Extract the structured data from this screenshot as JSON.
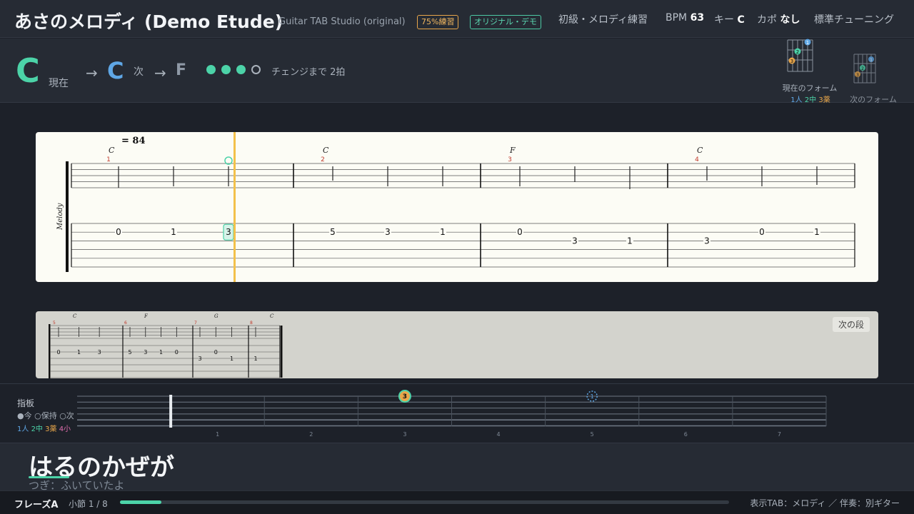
{
  "header": {
    "title": "あさのメロディ (Demo Etude)",
    "subtitle": "Guitar TAB Studio (original)",
    "badge_practice": "75%練習",
    "badge_demo": "オリジナル・デモ",
    "level": "初級・メロディ練習",
    "bpm_label": "BPM",
    "bpm_value": "63",
    "key_label": "キー",
    "key_value": "C",
    "capo_label": "カポ",
    "capo_value": "なし",
    "tuning": "標準チューニング"
  },
  "chords": {
    "current": "C",
    "current_label": "現在",
    "next": "C",
    "next_label": "次",
    "after": "F",
    "arrow": "→",
    "beats_total": 4,
    "beats_done": 3,
    "countdown": "チェンジまで 2拍",
    "current_form_label": "現在のフォーム",
    "next_form_label": "次のフォーム",
    "finger_legend": [
      "1人",
      "2中",
      "3薬"
    ]
  },
  "tab": {
    "tempo": "= 84",
    "track": "Melody",
    "measures": [
      {
        "num": "1",
        "chord": "C",
        "notes": [
          {
            "fret": "0",
            "str": 2
          },
          {
            "fret": "1",
            "str": 2
          },
          {
            "fret": "3",
            "str": 2
          }
        ]
      },
      {
        "num": "2",
        "chord": "C",
        "notes": [
          {
            "fret": "5",
            "str": 2
          },
          {
            "fret": "3",
            "str": 2
          },
          {
            "fret": "1",
            "str": 2
          }
        ]
      },
      {
        "num": "3",
        "chord": "F",
        "notes": [
          {
            "fret": "0",
            "str": 2
          },
          {
            "fret": "3",
            "str": 3
          },
          {
            "fret": "1",
            "str": 3
          }
        ]
      },
      {
        "num": "4",
        "chord": "C",
        "notes": [
          {
            "fret": "3",
            "str": 3
          },
          {
            "fret": "0",
            "str": 2
          },
          {
            "fret": "1",
            "str": 2
          }
        ]
      }
    ],
    "next_row_label": "次の段",
    "next_row": [
      {
        "num": "5",
        "chord": "C",
        "frets": [
          "0",
          "1",
          "3"
        ]
      },
      {
        "num": "6",
        "chord": "F",
        "frets": [
          "5",
          "3",
          "1",
          "0"
        ]
      },
      {
        "num": "7",
        "chord": "G",
        "frets": [
          "3",
          "0",
          "1"
        ]
      },
      {
        "num": "8",
        "chord": "C",
        "frets": [
          "1"
        ]
      }
    ]
  },
  "fretboard": {
    "label": "指板",
    "legend": "●今 ○保持 ○次",
    "fingers": [
      "1人",
      "2中",
      "3薬",
      "4小"
    ],
    "fret_numbers": [
      "1",
      "2",
      "3",
      "4",
      "5",
      "6",
      "7"
    ],
    "current_note": "3",
    "next_note": "1"
  },
  "lyrics": {
    "current": "はるのかぜが",
    "next": "つぎ：ふいていたよ"
  },
  "footer": {
    "phrase": "フレーズA",
    "bar": "小節 1 / 8",
    "progress": 0.068,
    "info": "表示TAB：メロディ ／ 伴奏：別ギター"
  },
  "colors": {
    "accent": "#4cd3a8",
    "next_chord": "#5fa7e6",
    "playhead": "#f3c14b",
    "finger1": "#5fa7e6",
    "finger2": "#4cd3a8",
    "finger3": "#e8a64a",
    "finger4": "#e36fb0"
  }
}
